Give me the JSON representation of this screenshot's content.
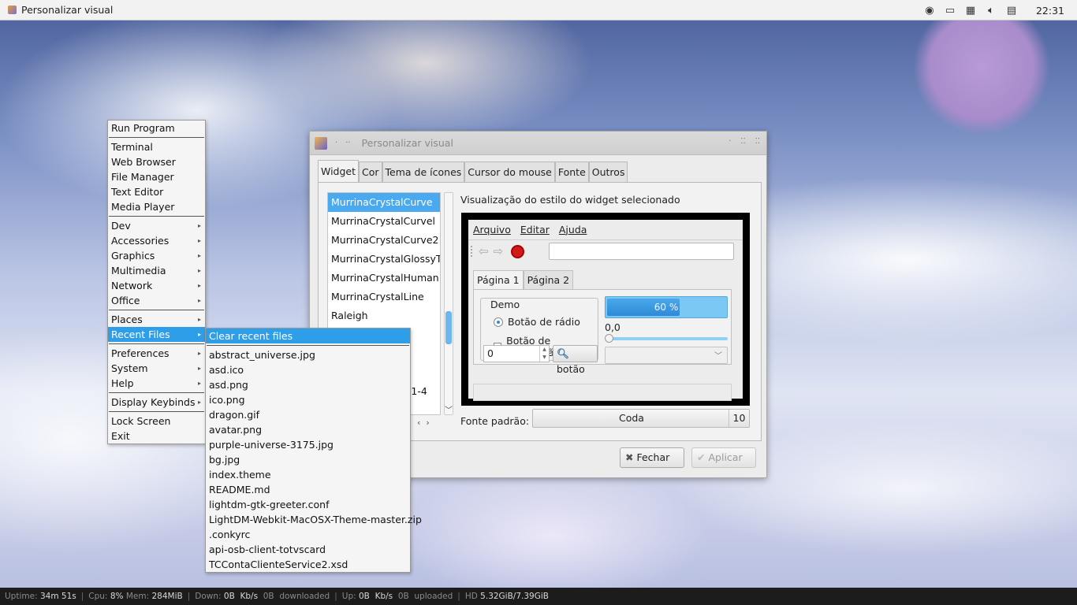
{
  "top_panel": {
    "app_title": "Personalizar visual",
    "tray_icons": [
      "accessibility-icon",
      "battery-icon",
      "network-icon",
      "volume-icon",
      "clipboard-icon"
    ],
    "clock": "22:31"
  },
  "status_bar": {
    "uptime_label": "Uptime:",
    "uptime": "34m 51s",
    "cpu_label": "Cpu:",
    "cpu": "8%",
    "mem_label": "Mem:",
    "mem": "284MiB",
    "down_label": "Down:",
    "down": "0B",
    "down_unit": "Kb/s",
    "down_total": "0B",
    "down_word": "downloaded",
    "up_label": "Up:",
    "up": "0B",
    "up_unit": "Kb/s",
    "up_total": "0B",
    "up_word": "uploaded",
    "hd_label": "HD",
    "hd": "5.32GiB/7.39GiB"
  },
  "root_menu": {
    "run_program": "Run Program",
    "apps": [
      "Terminal",
      "Web Browser",
      "File Manager",
      "Text Editor",
      "Media Player"
    ],
    "categories": [
      "Dev",
      "Accessories",
      "Graphics",
      "Multimedia",
      "Network",
      "Office"
    ],
    "places": "Places",
    "recent_files": "Recent Files",
    "settings": [
      "Preferences",
      "System",
      "Help"
    ],
    "display_keybinds": "Display Keybinds",
    "lock_screen": "Lock Screen",
    "exit": "Exit"
  },
  "recent_menu": {
    "clear": "Clear recent files",
    "files": [
      "abstract_universe.jpg",
      "asd.ico",
      "asd.png",
      "ico.png",
      "dragon.gif",
      "avatar.png",
      "purple-universe-3175.jpg",
      "bg.jpg",
      "index.theme",
      "README.md",
      "lightdm-gtk-greeter.conf",
      "LightDM-Webkit-MacOSX-Theme-master.zip",
      ".conkyrc",
      "api-osb-client-totvscard",
      "TCContaClienteService2.xsd"
    ]
  },
  "window": {
    "title": "Personalizar visual",
    "tabs": [
      "Widget",
      "Cor",
      "Tema de ícones",
      "Cursor do mouse",
      "Fonte",
      "Outros"
    ],
    "themes": [
      "MurrinaCrystalCurve",
      "MurrinaCrystalCurvel",
      "MurrinaCrystalCurve2",
      "MurrinaCrystalGlossyTo",
      "MurrinaCrystalHuman",
      "MurrinaCrystalLine",
      "Raleigh"
    ],
    "hidden_item_fragment": "t-1-4",
    "preview_title": "Visualização do estilo do widget selecionado",
    "preview": {
      "menu": [
        "Arquivo",
        "Editar",
        "Ajuda"
      ],
      "tabs": [
        "Página 1",
        "Página 2"
      ],
      "frame_label": "Demo",
      "radio": "Botão de rádio",
      "check": "Botão de verificação",
      "spin_value": "0",
      "button": "botão",
      "progress_text": "60 %",
      "progress_fraction": 0.6,
      "scale_value": "0,0"
    },
    "font_label": "Fonte padrão:",
    "font_name": "Coda",
    "font_size": "10",
    "close_label": "Fechar",
    "apply_label": "Aplicar"
  }
}
